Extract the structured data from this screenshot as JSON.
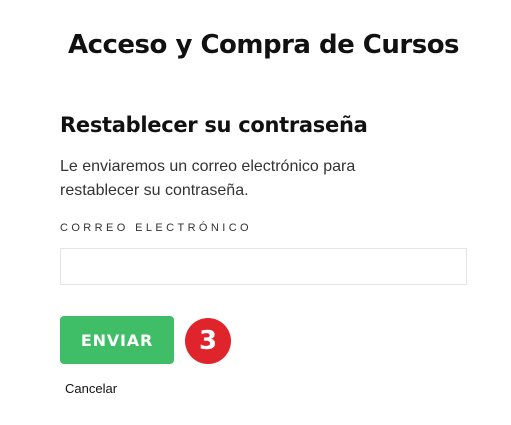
{
  "page": {
    "title": "Acceso y Compra de Cursos"
  },
  "form": {
    "heading": "Restablecer su contraseña",
    "description": "Le enviaremos un correo electrónico para restablecer su contraseña.",
    "email_label": "CORREO ELECTRÓNICO",
    "email_value": "",
    "submit_label": "ENVIAR",
    "cancel_label": "Cancelar"
  },
  "annotation": {
    "step_number": "3"
  },
  "colors": {
    "submit_button": "#3fbd67",
    "step_badge": "#e0242c",
    "input_border": "#e4e4e4"
  }
}
